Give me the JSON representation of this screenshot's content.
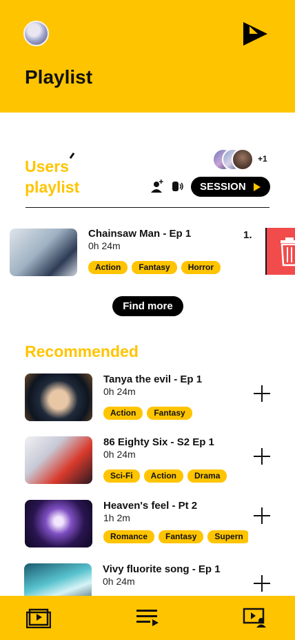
{
  "header": {
    "title": "Playlist"
  },
  "users_playlist": {
    "title_line1": "Users",
    "title_line2": "playlist",
    "extra_users": "+1",
    "session_label": "SESSION"
  },
  "playlist": [
    {
      "title": "Chainsaw Man - Ep 1",
      "duration": "0h 24m",
      "rank": "1.",
      "tags": [
        "Action",
        "Fantasy",
        "Horror"
      ]
    }
  ],
  "find_more_label": "Find more",
  "recommended": {
    "title": "Recommended",
    "items": [
      {
        "title": "Tanya the evil - Ep 1",
        "duration": "0h 24m",
        "tags": [
          "Action",
          "Fantasy"
        ]
      },
      {
        "title": "86 Eighty Six - S2 Ep 1",
        "duration": "0h 24m",
        "tags": [
          "Sci-Fi",
          "Action",
          "Drama"
        ]
      },
      {
        "title": "Heaven's feel - Pt 2",
        "duration": "1h 2m",
        "tags": [
          "Romance",
          "Fantasy",
          "Supern"
        ]
      },
      {
        "title": "Vivy fluorite song - Ep 1",
        "duration": "0h 24m",
        "tags": []
      }
    ]
  },
  "colors": {
    "accent": "#FFC400",
    "danger": "#F24B4B",
    "dark": "#000000"
  },
  "nav": {
    "icons": [
      "tv-icon",
      "playlist-icon",
      "session-users-icon"
    ]
  }
}
